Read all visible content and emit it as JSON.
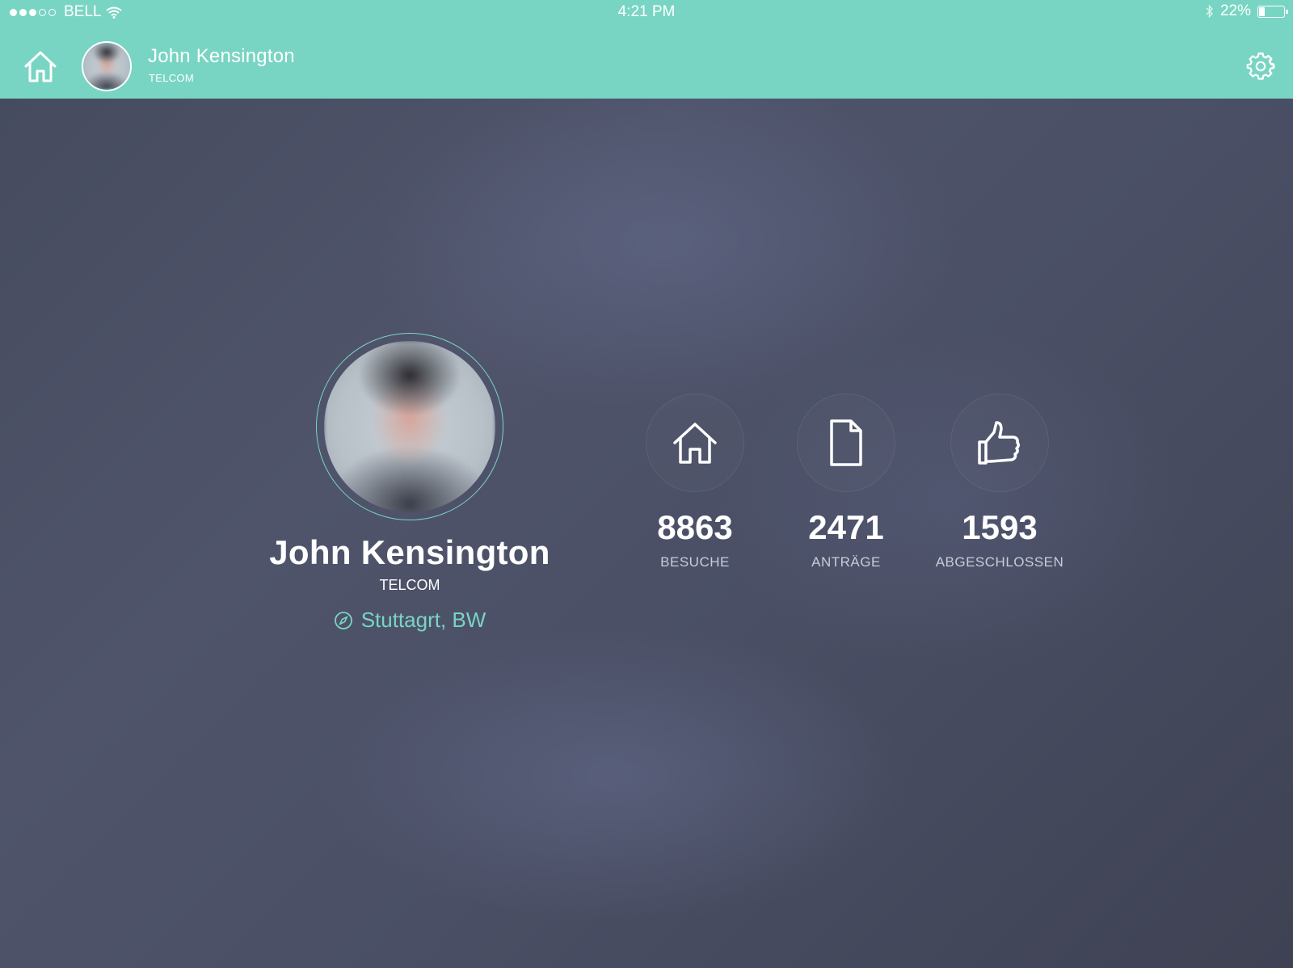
{
  "status_bar": {
    "carrier": "BELL",
    "time": "4:21 PM",
    "battery_percent": "22%",
    "battery_level": 0.22,
    "signal_bars_filled": 3,
    "signal_bars_total": 5
  },
  "header": {
    "user_name": "John Kensington",
    "company": "TELCOM",
    "accent_color": "#79d5c3"
  },
  "profile": {
    "name": "John Kensington",
    "company": "TELCOM",
    "location": "Stuttagrt, BW"
  },
  "stats": [
    {
      "icon": "house-icon",
      "value": "8863",
      "label": "BESUCHE"
    },
    {
      "icon": "document-icon",
      "value": "2471",
      "label": "ANTRÄGE"
    },
    {
      "icon": "thumbs-up-icon",
      "value": "1593",
      "label": "ABGESCHLOSSEN"
    }
  ]
}
